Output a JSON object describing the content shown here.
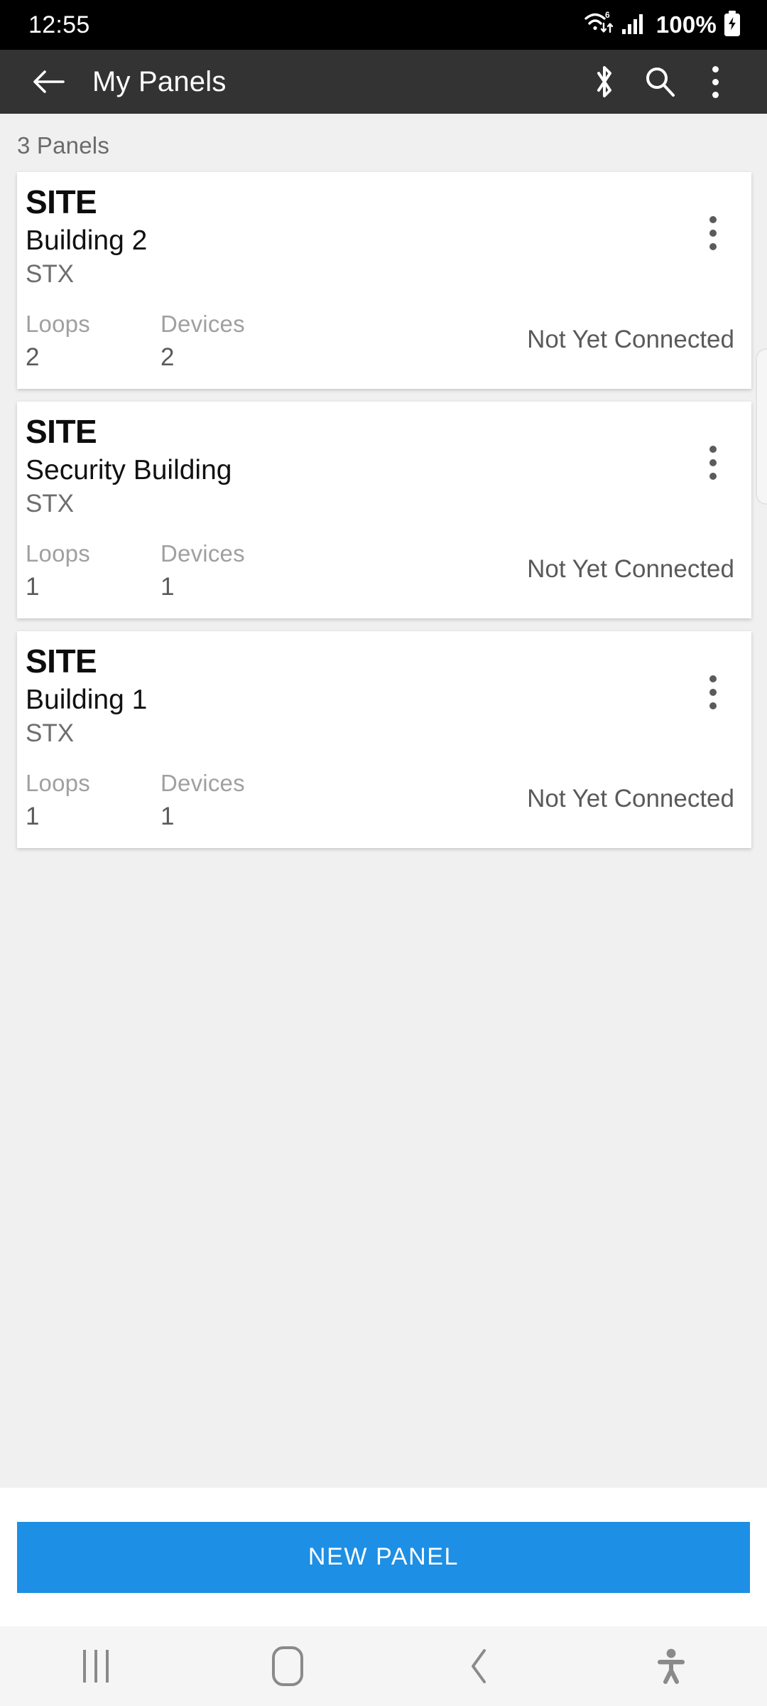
{
  "status_bar": {
    "time": "12:55",
    "battery_percent": "100%",
    "wifi_generation": "6",
    "icons": [
      "wifi-6-icon",
      "cellular-signal-icon",
      "battery-charging-icon"
    ]
  },
  "app_bar": {
    "back_label": "back-arrow",
    "title": "My Panels",
    "actions": [
      {
        "name": "bluetooth-icon",
        "label": "Bluetooth"
      },
      {
        "name": "search-icon",
        "label": "Search"
      },
      {
        "name": "overflow-menu-icon",
        "label": "More options"
      }
    ]
  },
  "content": {
    "count_label": "3 Panels",
    "stat_labels": {
      "loops": "Loops",
      "devices": "Devices"
    },
    "cards": [
      {
        "kind": "SITE",
        "name": "Building 2",
        "type": "STX",
        "loops": "2",
        "devices": "2",
        "status": "Not Yet Connected"
      },
      {
        "kind": "SITE",
        "name": "Security Building",
        "type": "STX",
        "loops": "1",
        "devices": "1",
        "status": "Not Yet Connected"
      },
      {
        "kind": "SITE",
        "name": "Building 1",
        "type": "STX",
        "loops": "1",
        "devices": "1",
        "status": "Not Yet Connected"
      }
    ]
  },
  "bottom_bar": {
    "new_panel_label": "NEW PANEL"
  },
  "nav_bar": {
    "items": [
      "recents-icon",
      "home-icon",
      "back-icon",
      "accessibility-icon"
    ]
  },
  "colors": {
    "status_bar_bg": "#000000",
    "app_bar_bg": "#333333",
    "page_bg": "#f0f0f0",
    "card_bg": "#ffffff",
    "accent_blue": "#1d8fe4",
    "muted_text": "#a0a0a0",
    "body_text": "#5a5a5a",
    "nav_bar_bg": "#f5f5f5"
  }
}
